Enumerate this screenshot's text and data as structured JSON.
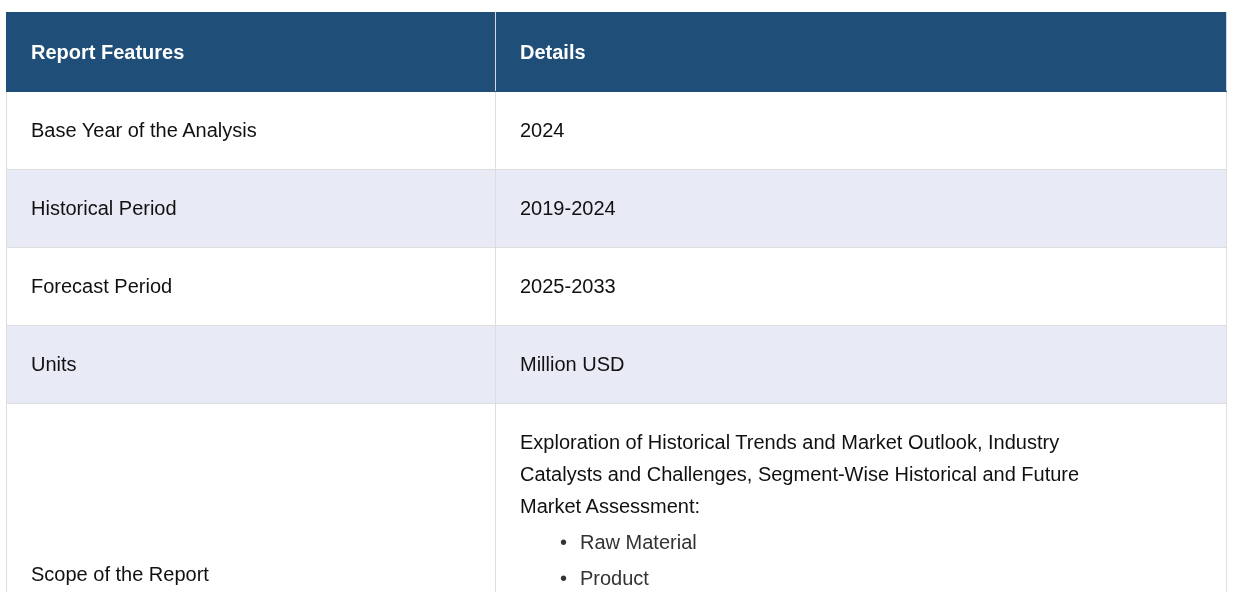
{
  "table": {
    "columns": [
      "Report Features",
      "Details"
    ],
    "rows": [
      {
        "feature": "Base Year of the Analysis",
        "details": "2024"
      },
      {
        "feature": "Historical Period",
        "details": "2019-2024"
      },
      {
        "feature": "Forecast Period",
        "details": "2025-2033"
      },
      {
        "feature": "Units",
        "details": "Million USD"
      },
      {
        "feature": "Scope of the Report",
        "details": "Exploration of Historical Trends and Market Outlook, Industry Catalysts and Challenges, Segment-Wise Historical and Future Market Assessment:",
        "bullets": [
          {
            "marker": "•",
            "text": "Raw Material"
          },
          {
            "marker": "•",
            "text": "Product"
          }
        ]
      }
    ]
  }
}
